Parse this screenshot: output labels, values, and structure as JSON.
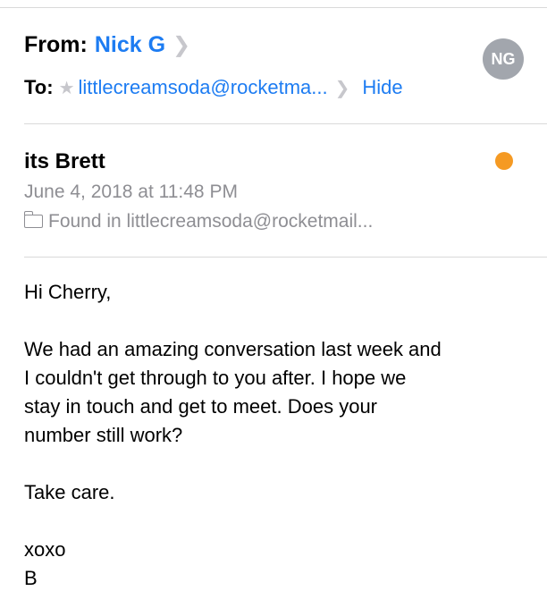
{
  "header": {
    "from_label": "From:",
    "from_name": "Nick G",
    "to_label": "To:",
    "to_address": "littlecreamsoda@rocketma...",
    "hide_label": "Hide",
    "avatar_initials": "NG"
  },
  "message": {
    "subject": "its Brett",
    "date": "June 4, 2018 at 11:48 PM",
    "found_in": "Found in littlecreamsoda@rocketmail...",
    "body": {
      "greeting": "Hi Cherry,",
      "line1": "We had an amazing conversation last week and",
      "line2": "I couldn't get through to you after.  I hope we",
      "line3": "stay in touch and get to meet.  Does your",
      "line4": "number still work?",
      "closing": "Take care.",
      "signoff": "xoxo",
      "signature": "B"
    }
  },
  "colors": {
    "link": "#1d7cf2",
    "unread_dot": "#f59a23",
    "secondary_text": "#8e8e93",
    "avatar_bg": "#a2a6ad"
  },
  "icons": [
    "chevron-right-icon",
    "star-icon",
    "folder-icon",
    "unread-dot-icon"
  ]
}
